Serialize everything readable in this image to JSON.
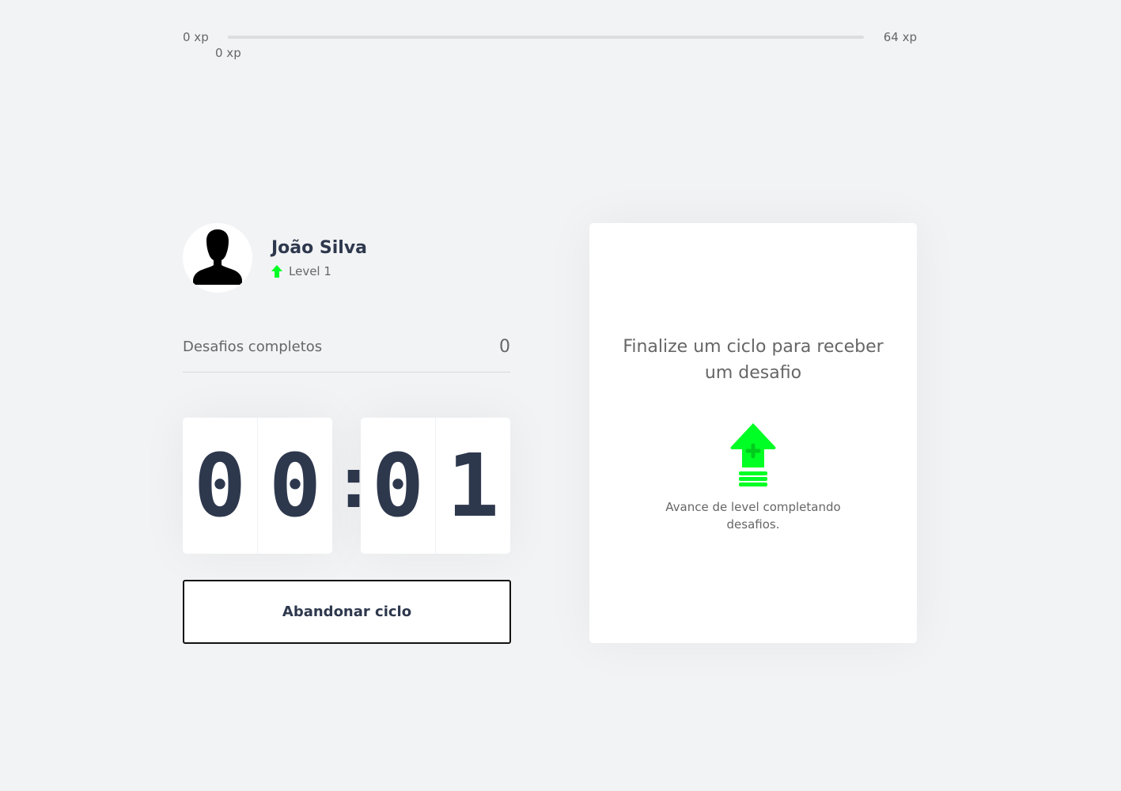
{
  "xp": {
    "min_label": "0 xp",
    "max_label": "64 xp",
    "current_label": "0 xp",
    "progress_fraction": 0
  },
  "profile": {
    "name": "João Silva",
    "level_label": "Level 1"
  },
  "stats": {
    "completed_label": "Desafios completos",
    "completed_value": "0"
  },
  "countdown": {
    "minutes": [
      "0",
      "0"
    ],
    "separator": ":",
    "seconds": [
      "0",
      "1"
    ]
  },
  "actions": {
    "abandon_label": "Abandonar ciclo"
  },
  "challenge": {
    "title": "Finalize um ciclo para receber um desafio",
    "hint": "Avance de level completando desafios."
  },
  "colors": {
    "background": "#F2F3F5",
    "text": "#666666",
    "title": "#2E384D",
    "green": "#00FF24",
    "level_up_green": "#4CD62B"
  },
  "icons": {
    "avatar": "person-silhouette-icon",
    "level": "level-up-arrow-icon",
    "challenge": "level-up-arrow-icon"
  }
}
